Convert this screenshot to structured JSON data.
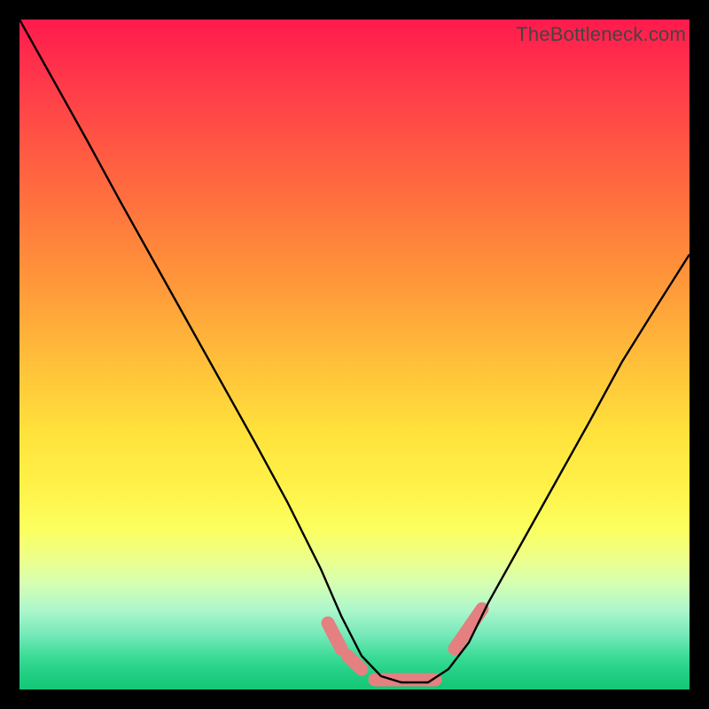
{
  "watermark": "TheBottleneck.com",
  "chart_data": {
    "type": "line",
    "title": "",
    "xlabel": "",
    "ylabel": "",
    "xlim": [
      0,
      100
    ],
    "ylim": [
      0,
      100
    ],
    "series": [
      {
        "name": "bottleneck-curve",
        "x": [
          0,
          5,
          10,
          15,
          20,
          25,
          30,
          35,
          40,
          45,
          48,
          51,
          54,
          57,
          59,
          61,
          64,
          67,
          70,
          75,
          80,
          85,
          90,
          95,
          100
        ],
        "values": [
          100,
          91,
          82,
          73,
          64,
          55,
          46,
          37,
          28,
          18,
          11,
          5,
          2,
          1,
          1,
          1,
          3,
          7,
          13,
          22,
          31,
          40,
          49,
          57,
          65
        ]
      }
    ],
    "markers": {
      "name": "recommended-band",
      "color": "#e48080",
      "segments": [
        {
          "x": [
            46,
            48
          ],
          "y": [
            10,
            6
          ]
        },
        {
          "x": [
            49,
            51
          ],
          "y": [
            5,
            3
          ]
        },
        {
          "x": [
            53,
            62
          ],
          "y": [
            1,
            1
          ]
        },
        {
          "x": [
            65,
            69
          ],
          "y": [
            6,
            12
          ]
        }
      ]
    },
    "background_gradient": {
      "top": "#ff1a4d",
      "mid": "#ffe33c",
      "bottom": "#13c775"
    }
  }
}
